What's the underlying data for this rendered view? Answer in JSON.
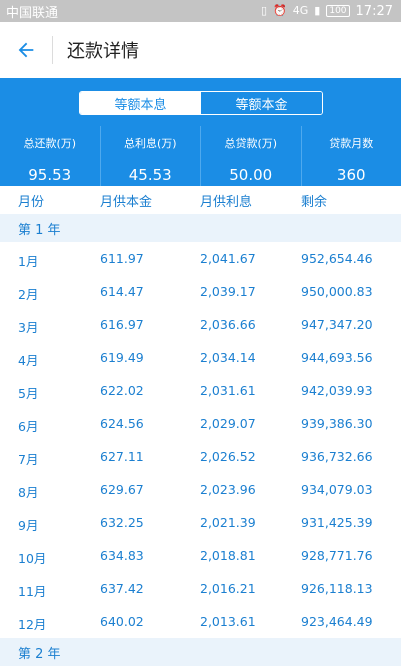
{
  "status_bar": {
    "carrier": "中国联通",
    "vibrate_icon": "vibrate-icon",
    "alarm_icon": "alarm-icon",
    "network": "4G",
    "battery": "100",
    "time": "17:27"
  },
  "header": {
    "title": "还款详情",
    "back_icon": "arrow-left-icon"
  },
  "tabs": [
    {
      "label": "等额本息",
      "active": true
    },
    {
      "label": "等额本金",
      "active": false
    }
  ],
  "summary": [
    {
      "label": "总还款(万)",
      "value": "95.53"
    },
    {
      "label": "总利息(万)",
      "value": "45.53"
    },
    {
      "label": "总贷款(万)",
      "value": "50.00"
    },
    {
      "label": "贷款月数",
      "value": "360"
    }
  ],
  "columns": [
    "月份",
    "月供本金",
    "月供利息",
    "剩余"
  ],
  "groups": [
    {
      "label": "第 1 年",
      "rows": [
        [
          "1月",
          "611.97",
          "2,041.67",
          "952,654.46"
        ],
        [
          "2月",
          "614.47",
          "2,039.17",
          "950,000.83"
        ],
        [
          "3月",
          "616.97",
          "2,036.66",
          "947,347.20"
        ],
        [
          "4月",
          "619.49",
          "2,034.14",
          "944,693.56"
        ],
        [
          "5月",
          "622.02",
          "2,031.61",
          "942,039.93"
        ],
        [
          "6月",
          "624.56",
          "2,029.07",
          "939,386.30"
        ],
        [
          "7月",
          "627.11",
          "2,026.52",
          "936,732.66"
        ],
        [
          "8月",
          "629.67",
          "2,023.96",
          "934,079.03"
        ],
        [
          "9月",
          "632.25",
          "2,021.39",
          "931,425.39"
        ],
        [
          "10月",
          "634.83",
          "2,018.81",
          "928,771.76"
        ],
        [
          "11月",
          "637.42",
          "2,016.21",
          "926,118.13"
        ],
        [
          "12月",
          "640.02",
          "2,013.61",
          "923,464.49"
        ]
      ]
    },
    {
      "label": "第 2 年",
      "rows": []
    }
  ],
  "colors": {
    "accent": "#1b8de5",
    "text_blue": "#1b7fd0",
    "group_bg": "#eaf3fb",
    "status_bg": "#c4c4c4"
  }
}
